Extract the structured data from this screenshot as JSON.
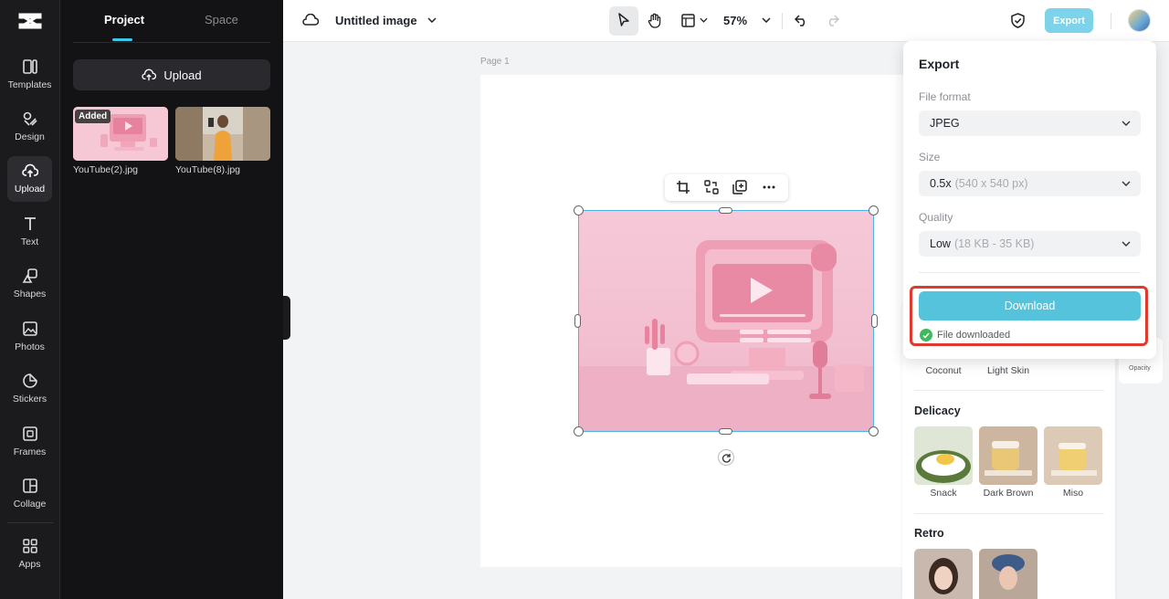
{
  "rail": {
    "items": [
      {
        "label": "Templates",
        "icon": "templates-icon"
      },
      {
        "label": "Design",
        "icon": "design-icon"
      },
      {
        "label": "Upload",
        "icon": "upload-cloud-icon"
      },
      {
        "label": "Text",
        "icon": "text-icon"
      },
      {
        "label": "Shapes",
        "icon": "shapes-icon"
      },
      {
        "label": "Photos",
        "icon": "photos-icon"
      },
      {
        "label": "Stickers",
        "icon": "stickers-icon"
      },
      {
        "label": "Frames",
        "icon": "frames-icon"
      },
      {
        "label": "Collage",
        "icon": "collage-icon"
      },
      {
        "label": "Apps",
        "icon": "apps-icon"
      }
    ],
    "active": "Upload"
  },
  "panel": {
    "tabs": [
      "Project",
      "Space"
    ],
    "upload_label": "Upload",
    "files": [
      {
        "name": "YouTube(2).jpg",
        "badge": "Added"
      },
      {
        "name": "YouTube(8).jpg"
      }
    ]
  },
  "topbar": {
    "title": "Untitled image",
    "zoom": "57%",
    "export_label": "Export"
  },
  "canvas": {
    "page_label": "Page 1"
  },
  "export_popover": {
    "title": "Export",
    "file_format_label": "File format",
    "file_format_value": "JPEG",
    "size_label": "Size",
    "size_value": "0.5x",
    "size_detail": "(540 x 540 px)",
    "quality_label": "Quality",
    "quality_value": "Low",
    "quality_detail": "(18 KB - 35 KB)",
    "download_label": "Download",
    "status_text": "File downloaded"
  },
  "filters": {
    "row0": [
      "Coconut",
      "Light Skin"
    ],
    "sections": [
      {
        "title": "Delicacy",
        "items": [
          "Snack",
          "Dark Brown",
          "Miso"
        ]
      },
      {
        "title": "Retro",
        "items": []
      }
    ],
    "side_label": "Opacity"
  },
  "colors": {
    "accent": "#55c3dc",
    "highlight": "#e0392e",
    "selection": "#4fb3e8"
  }
}
